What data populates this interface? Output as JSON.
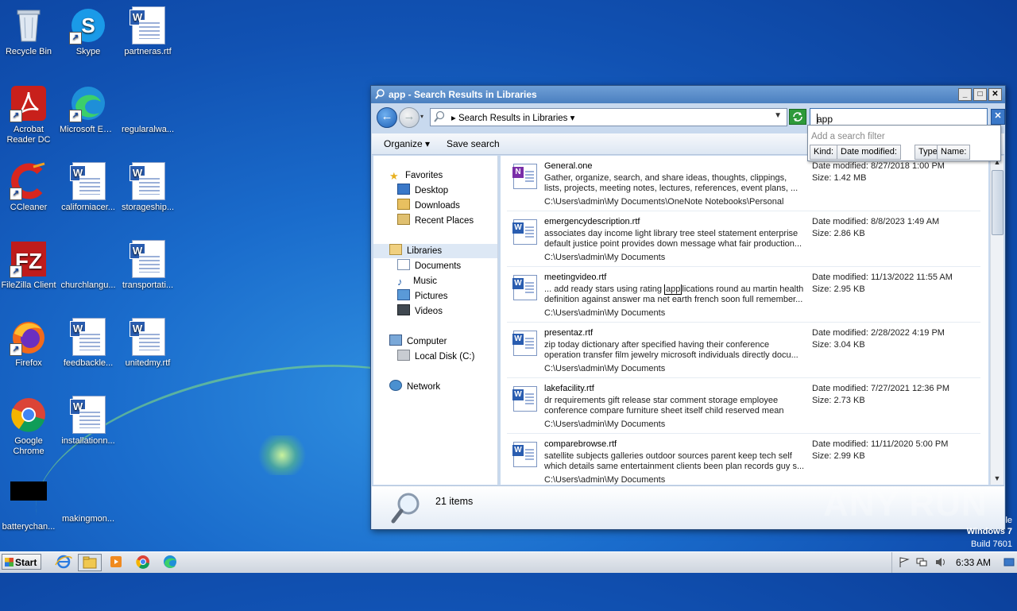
{
  "desktop": {
    "icons": [
      {
        "label": "Recycle Bin",
        "icon": "recycle-bin-icon"
      },
      {
        "label": "Skype",
        "icon": "skype-icon"
      },
      {
        "label": "partneras.rtf",
        "icon": "word-doc-icon"
      },
      {
        "label": "Acrobat Reader DC",
        "icon": "acrobat-icon"
      },
      {
        "label": "Microsoft Edge",
        "icon": "edge-icon"
      },
      {
        "label": "regularalwa...",
        "icon": "blank-file-icon"
      },
      {
        "label": "CCleaner",
        "icon": "ccleaner-icon"
      },
      {
        "label": "californiacer...",
        "icon": "word-doc-icon"
      },
      {
        "label": "storageship...",
        "icon": "word-doc-icon"
      },
      {
        "label": "FileZilla Client",
        "icon": "filezilla-icon"
      },
      {
        "label": "churchlangu...",
        "icon": "blank-file-icon"
      },
      {
        "label": "transportati...",
        "icon": "word-doc-icon"
      },
      {
        "label": "Firefox",
        "icon": "firefox-icon"
      },
      {
        "label": "feedbackle...",
        "icon": "word-doc-icon"
      },
      {
        "label": "unitedmy.rtf",
        "icon": "word-doc-icon"
      },
      {
        "label": "Google Chrome",
        "icon": "chrome-icon"
      },
      {
        "label": "installationn...",
        "icon": "word-doc-icon"
      },
      {
        "label": "batterychan...",
        "icon": "black-file-icon"
      },
      {
        "label": "makingmon...",
        "icon": "blank-file-icon"
      }
    ]
  },
  "window": {
    "title": "app - Search Results in Libraries",
    "breadcrumb": "Search Results in Libraries",
    "search_value": "app",
    "filter_hint": "Add a search filter",
    "filters": [
      "Kind:",
      "Date modified:",
      "Type:",
      "Name:"
    ],
    "toolbar": {
      "organize": "Organize",
      "save_search": "Save search"
    },
    "nav": {
      "favorites": "Favorites",
      "desktop": "Desktop",
      "downloads": "Downloads",
      "recent": "Recent Places",
      "libraries": "Libraries",
      "documents": "Documents",
      "music": "Music",
      "pictures": "Pictures",
      "videos": "Videos",
      "computer": "Computer",
      "local_disk": "Local Disk (C:)",
      "network": "Network"
    },
    "results": [
      {
        "name": "General.one",
        "line1": "Gather, organize, search, and share ideas, thoughts, clippings,",
        "line2": "lists, projects, meeting notes, lectures, references, event plans, ...",
        "path": "C:\\Users\\admin\\My Documents\\OneNote Notebooks\\Personal",
        "date": "Date modified: 8/27/2018 1:00 PM",
        "size": "Size: 1.42 MB"
      },
      {
        "name": "emergencydescription.rtf",
        "line1": "associates day income light library tree steel statement enterprise",
        "line2": "default justice point provides down message what fair production...",
        "path": "C:\\Users\\admin\\My Documents",
        "date": "Date modified: 8/8/2023 1:49 AM",
        "size": "Size: 2.86 KB"
      },
      {
        "name": "meetingvideo.rtf",
        "line1_pre": "... add ready stars using rating ",
        "line1_hl": "app",
        "line1_post": "lications round au martin health",
        "line2": "definition against answer ma net earth french soon full remember...",
        "path": "C:\\Users\\admin\\My Documents",
        "date": "Date modified: 11/13/2022 11:55 AM",
        "size": "Size: 2.95 KB"
      },
      {
        "name": "presentaz.rtf",
        "line1": "zip today dictionary after specified having their conference",
        "line2": "operation transfer film jewelry microsoft individuals directly docu...",
        "path": "C:\\Users\\admin\\My Documents",
        "date": "Date modified: 2/28/2022 4:19 PM",
        "size": "Size: 3.04 KB"
      },
      {
        "name": "lakefacility.rtf",
        "line1": "dr requirements gift release star comment storage employee",
        "line2": "conference compare furniture sheet itself child reserved mean",
        "path": "C:\\Users\\admin\\My Documents",
        "date": "Date modified: 7/27/2021 12:36 PM",
        "size": "Size: 2.73 KB"
      },
      {
        "name": "comparebrowse.rtf",
        "line1": "satellite subjects galleries outdoor sources parent keep tech self",
        "line2": "which details same entertainment clients been plan records guy s...",
        "path": "C:\\Users\\admin\\My Documents",
        "date": "Date modified: 11/11/2020 5:00 PM",
        "size": "Size: 2.99 KB"
      }
    ],
    "item_count": "21 items"
  },
  "watermark": "ANY RUN",
  "os": {
    "line0": "le",
    "line1": "Windows 7",
    "line2": "Build 7601"
  },
  "taskbar": {
    "start": "Start",
    "clock": "6:33 AM"
  }
}
